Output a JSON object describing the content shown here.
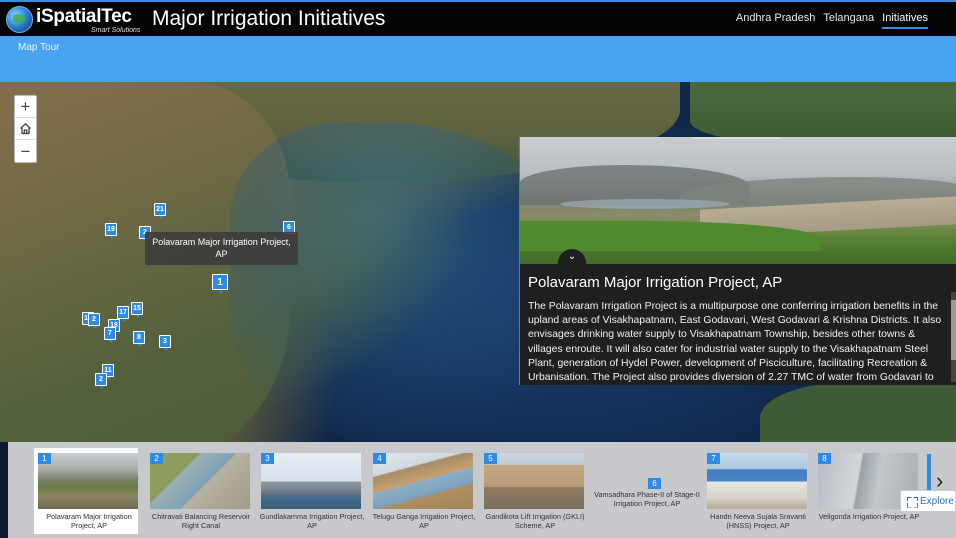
{
  "app": {
    "logo_name": "iSpatialTec",
    "logo_tagline": "Smart Solutions",
    "title": "Major Irrigation Initiatives"
  },
  "nav": {
    "items": [
      {
        "label": "Andhra Pradesh",
        "active": false
      },
      {
        "label": "Telangana",
        "active": false
      },
      {
        "label": "Initiatives",
        "active": true
      }
    ]
  },
  "subbar": {
    "label": "Map Tour"
  },
  "map_controls": {
    "zoom_in": "+",
    "home_icon": "home-icon",
    "zoom_out": "−"
  },
  "markers": [
    "1",
    "2",
    "3",
    "6",
    "8",
    "11",
    "12",
    "15",
    "17",
    "18",
    "19",
    "21",
    "2",
    "7",
    "2"
  ],
  "tooltip": {
    "text": "Polavaram Major Irrigation Project, AP"
  },
  "panel": {
    "title": "Polavaram Major Irrigation Project, AP",
    "toggle_icon": "⌄",
    "description": "The Polavaram Irrigation Project is a multipurpose one conferring irrigation benefits in the upland areas of Visakhapatnam, East Godavari, West Godavari & Krishna Districts. It also envisages drinking water supply to Visakhapatnam Township, besides other towns & villages enroute. It will also cater for industrial water supply to the Visakhapatnam Steel Plant, generation of Hydel Power, development of Pisciculture, facilitating Recreation & Urbanisation. The Project also provides diversion of 2.27 TMC of water from Godavari to"
  },
  "carousel": {
    "items": [
      {
        "num": "1",
        "caption": "Polavaram Major Irrigation Project, AP",
        "active": true
      },
      {
        "num": "2",
        "caption": "Chitravati Balancing Reservoir Right Canal",
        "active": false
      },
      {
        "num": "3",
        "caption": "Gundlakamma Irrigation Project, AP",
        "active": false
      },
      {
        "num": "4",
        "caption": "Telugu Ganga Irrigation Project, AP",
        "active": false
      },
      {
        "num": "5",
        "caption": "Gandikota Lift Irrigation (GKLI) Scheme, AP",
        "active": false
      },
      {
        "num": "6",
        "caption": "Vamsadhara Phase-II of Stage-II Irrigation Project, AP",
        "active": false
      },
      {
        "num": "7",
        "caption": "Handri Neeva Sujala Sravanti (HNSS) Project, AP",
        "active": false
      },
      {
        "num": "8",
        "caption": "Veligonda Irrigation Project, AP",
        "active": false
      }
    ],
    "next_icon": "›",
    "explore_label": "Explore"
  }
}
